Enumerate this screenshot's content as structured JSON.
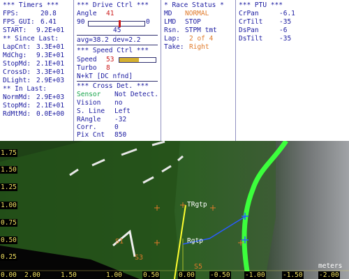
{
  "timers": {
    "header": "*** Timers ***",
    "rows": [
      {
        "k": "FPS:",
        "v": "20.8"
      },
      {
        "k": "FPS_GUI:",
        "v": "6.41"
      },
      {
        "k": "START:",
        "v": "9.2E+01"
      }
    ],
    "since_header": "** Since Last:",
    "since_rows": [
      {
        "k": "LapCnt:",
        "v": "3.3E+01"
      },
      {
        "k": "MdChg:",
        "v": "9.3E+01"
      },
      {
        "k": "StopMd:",
        "v": "2.1E+01"
      },
      {
        "k": "CrossD:",
        "v": "3.3E+01"
      },
      {
        "k": "DLight:",
        "v": "2.9E+03"
      }
    ],
    "in_header": "** In Last:",
    "in_rows": [
      {
        "k": "NormMd:",
        "v": "2.9E+03"
      },
      {
        "k": "StopMd:",
        "v": "2.1E+01"
      },
      {
        "k": "RdMtMd:",
        "v": "0.0E+00"
      }
    ]
  },
  "drive": {
    "header": "*** Drive Ctrl ***",
    "angle_label": "Angle",
    "angle_value": "41",
    "slider_min": "90",
    "slider_max": "0",
    "slider_fraction": 0.54,
    "slider_center": "45",
    "stats": "avg=38.2 dev=2.2",
    "speed_header": "*** Speed Ctrl ***",
    "speed_label": "Speed",
    "speed_value": "53",
    "speed_fraction": 0.53,
    "turbo_label": "Turbo",
    "turbo_value": "8",
    "nkt": "N+kT [DC nfnd]",
    "cross_header": "*** Cross Det. ***",
    "cross_rows": [
      {
        "k": "Sensor",
        "v": "Not Detect.",
        "kc": "green"
      },
      {
        "k": "Vision",
        "v": "no"
      },
      {
        "k": "S. Line",
        "v": "Left"
      },
      {
        "k": "RAngle",
        "v": "-32"
      },
      {
        "k": "Corr.",
        "v": "0"
      },
      {
        "k": "Pix Cnt",
        "v": "850"
      }
    ]
  },
  "race": {
    "header": "* Race Status *",
    "rows": [
      {
        "k": "MD",
        "v": "NORMAL",
        "vc": "orange"
      },
      {
        "k": "LMD",
        "v": "STOP",
        "vc": ""
      },
      {
        "k": "Rsn.",
        "v": "STPM tmt",
        "vc": ""
      },
      {
        "k": "Lap:",
        "v": "2 of 4",
        "vc": "orange"
      },
      {
        "k": "Take:",
        "v": "Right",
        "vc": "orange"
      }
    ]
  },
  "ptu": {
    "header": "*** PTU ***",
    "rows": [
      {
        "k": "CrPan",
        "v": "-6.1"
      },
      {
        "k": "CrTilt",
        "v": "-35"
      },
      {
        "k": "DsPan",
        "v": "-6"
      },
      {
        "k": "DsTilt",
        "v": "-35"
      }
    ]
  },
  "view": {
    "y_ticks": [
      "1.75",
      "1.50",
      "1.25",
      "1.00",
      "0.75",
      "0.50",
      "0.25",
      "0.00"
    ],
    "x_ticks": [
      "2.00",
      "1.50",
      "1.00",
      "0.50",
      "0.00",
      "-0.50",
      "-1.00",
      "-1.50",
      "-2.00"
    ],
    "units": "meters",
    "target_top": "TRgtp",
    "target_mid": "Rgtp",
    "marker_s1": "S1",
    "marker_s3": "S3",
    "marker_s5": "S5",
    "colors": {
      "lane": "#3cff3c",
      "dash": "#e8e8e8",
      "ground": "#2a5a20",
      "target": "#ffff30"
    }
  }
}
